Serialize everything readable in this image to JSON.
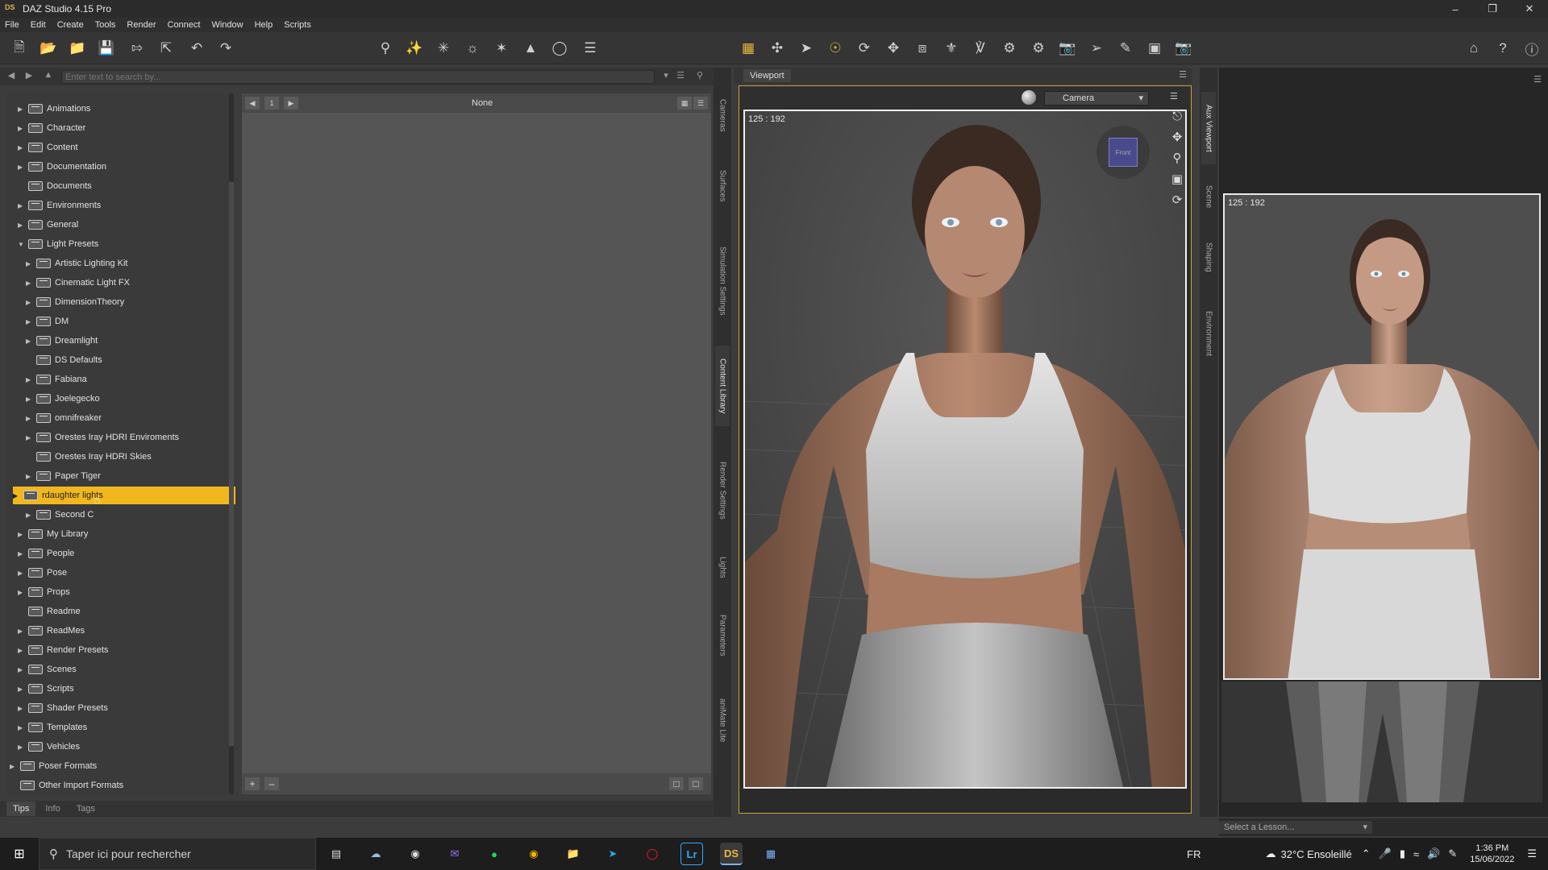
{
  "window": {
    "title": "DAZ Studio 4.15 Pro",
    "icon": "daz-studio-icon",
    "app_badge": "DS"
  },
  "menu": [
    "File",
    "Edit",
    "Create",
    "Tools",
    "Render",
    "Connect",
    "Window",
    "Help",
    "Scripts"
  ],
  "library": {
    "search_placeholder": "Enter text to search by...",
    "tree": [
      {
        "label": "Animations",
        "level": 0,
        "arrow": true
      },
      {
        "label": "Character",
        "level": 0,
        "arrow": true
      },
      {
        "label": "Content",
        "level": 0,
        "arrow": true
      },
      {
        "label": "Documentation",
        "level": 0,
        "arrow": true
      },
      {
        "label": "Documents",
        "level": 0,
        "arrow": false
      },
      {
        "label": "Environments",
        "level": 0,
        "arrow": true
      },
      {
        "label": "General",
        "level": 0,
        "arrow": true
      },
      {
        "label": "Light Presets",
        "level": 0,
        "arrow": true,
        "expanded": true
      },
      {
        "label": "Artistic Lighting Kit",
        "level": 1,
        "arrow": true
      },
      {
        "label": "Cinematic Light FX",
        "level": 1,
        "arrow": true
      },
      {
        "label": "DimensionTheory",
        "level": 1,
        "arrow": true
      },
      {
        "label": "DM",
        "level": 1,
        "arrow": true
      },
      {
        "label": "Dreamlight",
        "level": 1,
        "arrow": true
      },
      {
        "label": "DS Defaults",
        "level": 1,
        "arrow": false
      },
      {
        "label": "Fabiana",
        "level": 1,
        "arrow": true
      },
      {
        "label": "Joelegecko",
        "level": 1,
        "arrow": true
      },
      {
        "label": "omnifreaker",
        "level": 1,
        "arrow": true
      },
      {
        "label": "Orestes Iray HDRI Enviroments",
        "level": 1,
        "arrow": true
      },
      {
        "label": "Orestes Iray HDRI Skies",
        "level": 1,
        "arrow": false
      },
      {
        "label": "Paper Tiger",
        "level": 1,
        "arrow": true
      },
      {
        "label": "rdaughter lights",
        "level": 1,
        "arrow": true,
        "selected": true
      },
      {
        "label": "Second C",
        "level": 1,
        "arrow": true
      },
      {
        "label": "My Library",
        "level": 0,
        "arrow": true
      },
      {
        "label": "People",
        "level": 0,
        "arrow": true
      },
      {
        "label": "Pose",
        "level": 0,
        "arrow": true
      },
      {
        "label": "Props",
        "level": 0,
        "arrow": true
      },
      {
        "label": "Readme",
        "level": 0,
        "arrow": false
      },
      {
        "label": "ReadMes",
        "level": 0,
        "arrow": true
      },
      {
        "label": "Render Presets",
        "level": 0,
        "arrow": true
      },
      {
        "label": "Scenes",
        "level": 0,
        "arrow": true
      },
      {
        "label": "Scripts",
        "level": 0,
        "arrow": true
      },
      {
        "label": "Shader Presets",
        "level": 0,
        "arrow": true
      },
      {
        "label": "Templates",
        "level": 0,
        "arrow": true
      },
      {
        "label": "Vehicles",
        "level": 0,
        "arrow": true
      },
      {
        "label": "Poser Formats",
        "level": -1,
        "arrow": true
      },
      {
        "label": "Other Import Formats",
        "level": -1,
        "arrow": false
      }
    ],
    "page_number": "1",
    "content_title": "None",
    "bottom_tabs": [
      "Tips",
      "Info",
      "Tags"
    ]
  },
  "side_tabs": [
    "Cameras",
    "Surfaces",
    "Simulation Settings",
    "Content Library",
    "Render Settings",
    "Lights",
    "Parameters",
    "aniMate Lite"
  ],
  "viewport": {
    "tab": "Viewport",
    "camera": "Camera",
    "coords": "125 : 192",
    "cube_label": "Front"
  },
  "aux": {
    "tabs": [
      "Aux Viewport",
      "Scene",
      "Shaping",
      "Environment"
    ],
    "coords": "125 : 192",
    "lesson_placeholder": "Select a Lesson..."
  },
  "taskbar": {
    "search_placeholder": "Taper ici pour rechercher",
    "lang": "FR",
    "weather": "32°C  Ensoleillé",
    "time": "1:36 PM",
    "date": "15/06/2022",
    "ds_label": "DS",
    "lr_label": "Lr"
  },
  "colors": {
    "accent": "#f1b81e",
    "viewport_border": "#c9a13b"
  }
}
